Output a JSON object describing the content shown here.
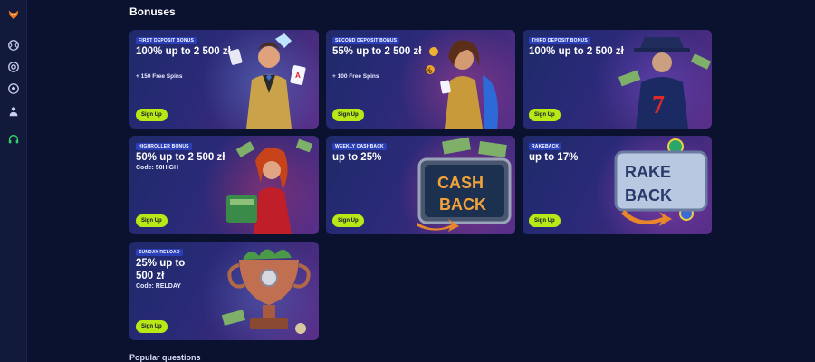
{
  "page": {
    "title": "Bonuses",
    "footer_heading": "Popular questions"
  },
  "sidebar": {
    "icons": [
      "fox-logo-icon",
      "tennis-ball-icon",
      "target-icon",
      "soccer-ball-icon",
      "person-icon",
      "headset-icon"
    ]
  },
  "cards": [
    {
      "badge": "FIRST DEPOSIT BONUS",
      "headline": "100% up to 2 500 zł",
      "sub": "+ 150 Free Spins",
      "button": "Sign Up",
      "art": "man-gold-suit-cards"
    },
    {
      "badge": "SECOND DEPOSIT BONUS",
      "headline": "55% up to 2 500 zł",
      "sub": "+ 100 Free Spins",
      "button": "Sign Up",
      "art": "woman-gold-dress-coins"
    },
    {
      "badge": "THIRD DEPOSIT BONUS",
      "headline": "100% up to 2 500 zł",
      "sub": "",
      "button": "Sign Up",
      "art": "man-hat-seven"
    },
    {
      "badge": "HIGHROLLER BONUS",
      "headline": "50% up to 2 500 zł",
      "sub": "Code: 50HIGH",
      "button": "Sign Up",
      "art": "woman-red-money"
    },
    {
      "badge": "WEEKLY CASHBACK",
      "headline": "up to 25%",
      "sub": "",
      "button": "Sign Up",
      "art": "cash-back-sign"
    },
    {
      "badge": "RAKEBACK",
      "headline": "up to 17%",
      "sub": "",
      "button": "Sign Up",
      "art": "rake-back-sign"
    },
    {
      "badge": "SUNDAY RELOAD",
      "headline": "25% up to 500 zł",
      "sub": "Code: RELDAY",
      "button": "Sign Up",
      "art": "trophy-money"
    }
  ],
  "art_text": {
    "cash": "CASH",
    "back": "BACK",
    "rake": "RAKE",
    "seven": "7"
  },
  "colors": {
    "accent": "#b8e816",
    "background": "#0b1230",
    "badge": "#2a3fb8"
  }
}
